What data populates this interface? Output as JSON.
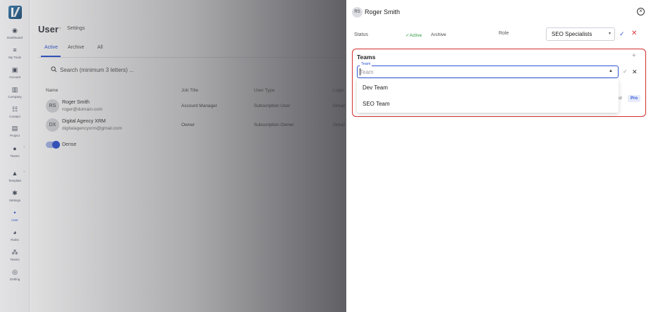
{
  "sidebar": {
    "items": [
      {
        "label": "Dashboard",
        "icon": "dashboard-icon"
      },
      {
        "label": "My Tools",
        "icon": "tools-icon"
      },
      {
        "label": "Account",
        "icon": "account-icon"
      },
      {
        "label": "Company",
        "icon": "company-icon"
      },
      {
        "label": "Contact",
        "icon": "contact-icon"
      },
      {
        "label": "Project",
        "icon": "project-icon"
      },
      {
        "label": "Teams",
        "icon": "teams-icon"
      },
      {
        "label": "Template",
        "icon": "template-icon"
      },
      {
        "label": "Settings",
        "icon": "settings-icon"
      },
      {
        "label": "User",
        "icon": "user-icon"
      },
      {
        "label": "Roles",
        "icon": "roles-icon"
      },
      {
        "label": "Teams",
        "icon": "teams-icon"
      },
      {
        "label": "Getting",
        "icon": "help-icon"
      }
    ]
  },
  "header": {
    "title": "User",
    "breadcrumb": "Settings"
  },
  "tabs": [
    {
      "label": "Active"
    },
    {
      "label": "Archive"
    },
    {
      "label": "All"
    }
  ],
  "search": {
    "placeholder": "Search (minimum 3 letters) ..."
  },
  "table": {
    "columns": [
      "Name",
      "Job Title",
      "User Type",
      "Login"
    ],
    "rows": [
      {
        "initials": "RS",
        "name": "Roger Smith",
        "email": "roger@domain.com",
        "job_title": "Account Manager",
        "user_type": "Subscription User",
        "login": "Gmail"
      },
      {
        "initials": "DX",
        "name": "Digital Agency XRM",
        "email": "digitalagencyxrm@gmail.com",
        "job_title": "Owner",
        "user_type": "Subscription Owner",
        "login": "Gmail"
      }
    ]
  },
  "dense": {
    "label": "Dense",
    "on": true
  },
  "drawer": {
    "initials": "RS",
    "name": "Roger Smith",
    "status_label": "Status",
    "status_active": "Active",
    "status_archive": "Archive",
    "role_label": "Role",
    "role_value": "SEO Specialists",
    "teams": {
      "title": "Teams",
      "field_label": "Team",
      "placeholder": "Team",
      "options": [
        "Dev Team",
        "SEO Team"
      ]
    },
    "peek_text": "ol",
    "badge": "Pro"
  },
  "colors": {
    "accent": "#2f55d4",
    "danger": "#d32f2f",
    "success": "#2e9b45"
  }
}
